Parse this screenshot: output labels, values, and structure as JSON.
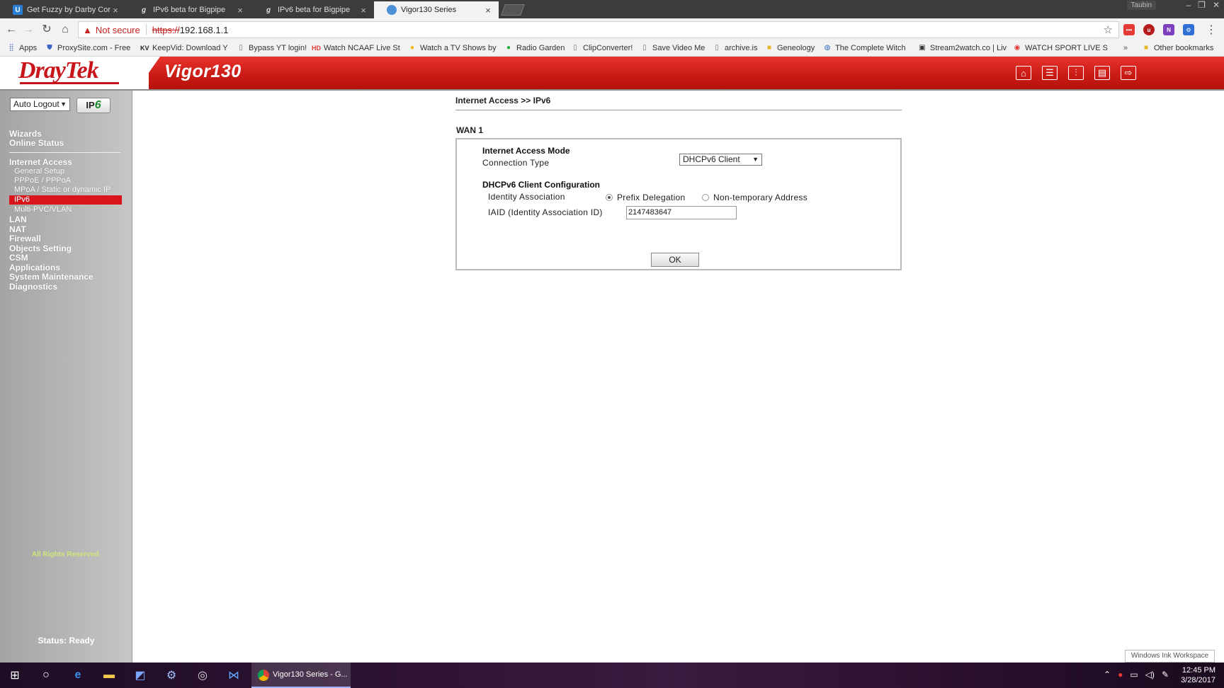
{
  "browser": {
    "tabs": [
      {
        "title": "Get Fuzzy by Darby Conl",
        "active": false
      },
      {
        "title": "IPv6 beta for Bigpipe",
        "active": false
      },
      {
        "title": "IPv6 beta for Bigpipe",
        "active": false
      },
      {
        "title": "Vigor130 Series",
        "active": true
      }
    ],
    "tab_close_glyph": "×",
    "window_user": "Taubin",
    "security_label": "Not secure",
    "url_scheme": "https://",
    "url_host": "192.168.1.1",
    "bookmarks": [
      {
        "label": "Apps",
        "icon": "apps-grid-icon"
      },
      {
        "label": "ProxySite.com - Free",
        "icon": "shield-icon"
      },
      {
        "label": "KeepVid: Download Y",
        "icon": "kv-icon"
      },
      {
        "label": "Bypass YT login!",
        "icon": "page-icon"
      },
      {
        "label": "Watch NCAAF Live St",
        "icon": "hd-icon"
      },
      {
        "label": "Watch a TV Shows by",
        "icon": "tv-icon"
      },
      {
        "label": "Radio Garden",
        "icon": "dot-icon"
      },
      {
        "label": "ClipConverter!",
        "icon": "page-icon"
      },
      {
        "label": "Save Video Me",
        "icon": "page-icon"
      },
      {
        "label": "archive.is",
        "icon": "page-icon"
      },
      {
        "label": "Geneology",
        "icon": "folder-icon"
      },
      {
        "label": "The Complete Witch",
        "icon": "globe-icon"
      },
      {
        "label": "Stream2watch.co | Liv",
        "icon": "stream-icon"
      },
      {
        "label": "WATCH SPORT LIVE S",
        "icon": "sport-icon"
      }
    ],
    "bookmarks_overflow": "»",
    "other_bookmarks": "Other bookmarks"
  },
  "router": {
    "brand": "DrayTek",
    "model": "Vigor130",
    "header_icons": [
      "home-icon",
      "list-icon",
      "sliders-icon",
      "save-icon",
      "logout-icon"
    ]
  },
  "sidebar": {
    "auto_logout": "Auto Logout",
    "ipv6_button": {
      "prefix": "IP",
      "suffix": "6"
    },
    "menu": {
      "wizards": "Wizards",
      "online_status": "Online Status",
      "internet_access": "Internet Access",
      "general_setup": "General Setup",
      "pppoe": "PPPoE / PPPoA",
      "mpoa": "MPoA / Static or dynamic IP",
      "ipv6": "IPv6",
      "multi_pvc": "Multi-PVC/VLAN",
      "lan": "LAN",
      "nat": "NAT",
      "firewall": "Firewall",
      "objects": "Objects Setting",
      "csm": "CSM",
      "applications": "Applications",
      "system_maintenance": "System Maintenance",
      "diagnostics": "Diagnostics"
    },
    "rights": "All Rights Reserved.",
    "status": "Status: Ready"
  },
  "main": {
    "breadcrumb": "Internet Access >> IPv6",
    "wan_label": "WAN 1",
    "access_mode_heading": "Internet Access Mode",
    "connection_type_label": "Connection Type",
    "connection_type_value": "DHCPv6 Client",
    "client_config_heading": "DHCPv6 Client Configuration",
    "identity_association_label": "Identity Association",
    "option_prefix": "Prefix Delegation",
    "option_nontemp": "Non-temporary Address",
    "selected_option": "Prefix Delegation",
    "iaid_label": "IAID (Identity Association ID)",
    "iaid_value": "2147483647",
    "ok_button": "OK"
  },
  "os": {
    "ink_tooltip": "Windows Ink Workspace",
    "taskbar_app": "Vigor130 Series - G...",
    "clock_time": "12:45 PM",
    "clock_date": "3/28/2017"
  }
}
